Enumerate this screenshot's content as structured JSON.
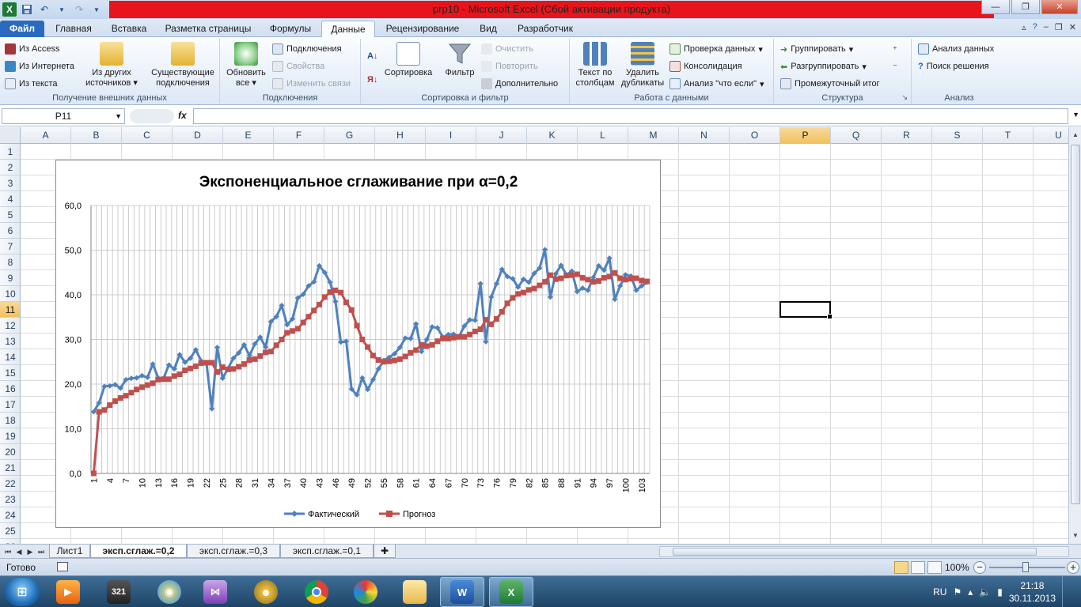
{
  "window": {
    "title": "prp10 -  Microsoft Excel (Сбой активации продукта)"
  },
  "tabs": [
    "Файл",
    "Главная",
    "Вставка",
    "Разметка страницы",
    "Формулы",
    "Данные",
    "Рецензирование",
    "Вид",
    "Разработчик"
  ],
  "ribbon": {
    "external": {
      "label": "Получение внешних данных",
      "access": "Из Access",
      "web": "Из Интернета",
      "text": "Из текста",
      "other1": "Из других",
      "other2": "источников",
      "existing1": "Существующие",
      "existing2": "подключения"
    },
    "connections": {
      "label": "Подключения",
      "refresh1": "Обновить",
      "refresh2": "все",
      "conn": "Подключения",
      "props": "Свойства",
      "links": "Изменить связи"
    },
    "sortfilter": {
      "label": "Сортировка и фильтр",
      "sort": "Сортировка",
      "filter": "Фильтр",
      "clear": "Очистить",
      "reapply": "Повторить",
      "advanced": "Дополнительно"
    },
    "datatools": {
      "label": "Работа с данными",
      "ttc1": "Текст по",
      "ttc2": "столбцам",
      "dup1": "Удалить",
      "dup2": "дубликаты",
      "validate": "Проверка данных",
      "consolidate": "Консолидация",
      "whatif": "Анализ \"что если\""
    },
    "outline": {
      "label": "Структура",
      "group": "Группировать",
      "ungroup": "Разгруппировать",
      "subtotal": "Промежуточный итог"
    },
    "analysis": {
      "label": "Анализ",
      "data": "Анализ данных",
      "solver": "Поиск решения"
    }
  },
  "formula_bar": {
    "name_box": "P11",
    "fx": "fx",
    "value": ""
  },
  "columns": [
    "A",
    "B",
    "C",
    "D",
    "E",
    "F",
    "G",
    "H",
    "I",
    "J",
    "K",
    "L",
    "M",
    "N",
    "O",
    "P",
    "Q",
    "R",
    "S",
    "T",
    "U"
  ],
  "rows": [
    "1",
    "2",
    "3",
    "4",
    "5",
    "6",
    "7",
    "8",
    "9",
    "10",
    "11",
    "12",
    "13",
    "14",
    "15",
    "16",
    "17",
    "18",
    "19",
    "20",
    "21",
    "22",
    "23",
    "24",
    "25",
    "26"
  ],
  "selected": {
    "column": "P",
    "row": "11"
  },
  "sheets": [
    "Лист1",
    "эксп.сглаж.=0,2",
    "эксп.сглаж.=0,3",
    "эксп.сглаж.=0,1"
  ],
  "active_sheet": 1,
  "status": {
    "ready": "Готово",
    "zoom": "100%"
  },
  "tray": {
    "lang": "RU",
    "time": "21:18",
    "date": "30.11.2013"
  },
  "colors": {
    "actual": "#4f81bd",
    "forecast": "#c0504d",
    "title_bar": "#e8141b"
  },
  "icons": [
    "excel-icon",
    "save-icon",
    "undo-icon",
    "redo-icon",
    "start-orb-icon",
    "media-player-icon",
    "clapper-icon",
    "browser-icon",
    "visual-studio-icon",
    "bird-icon",
    "chrome-icon",
    "colorful-app-icon",
    "folder-icon",
    "word-icon",
    "excel-taskbar-icon"
  ],
  "chart_data": {
    "type": "line",
    "title": "Экспоненциальное сглаживание при α=0,2",
    "xlabel": "",
    "ylabel": "",
    "ylim": [
      0,
      60
    ],
    "yticks": [
      "0,0",
      "10,0",
      "20,0",
      "30,0",
      "40,0",
      "50,0",
      "60,0"
    ],
    "xticks": [
      1,
      4,
      7,
      10,
      13,
      16,
      19,
      22,
      25,
      28,
      31,
      34,
      37,
      40,
      43,
      46,
      49,
      52,
      55,
      58,
      61,
      64,
      67,
      70,
      73,
      76,
      79,
      82,
      85,
      88,
      91,
      94,
      97,
      100,
      103
    ],
    "x_range": [
      1,
      104
    ],
    "grid": "vertical+horizontal",
    "legend_position": "bottom",
    "series": [
      {
        "name": "Фактический",
        "color": "#4f81bd",
        "marker": "diamond",
        "values": [
          13.8,
          15.8,
          19.5,
          19.6,
          19.9,
          19.1,
          21.0,
          21.3,
          21.4,
          21.9,
          21.5,
          24.5,
          21.4,
          21.3,
          24.3,
          23.4,
          26.6,
          24.9,
          25.8,
          27.7,
          25.2,
          24.5,
          14.5,
          28.2,
          21.3,
          23.5,
          25.8,
          27.0,
          28.8,
          26.4,
          29.0,
          30.5,
          28.3,
          34.0,
          35.1,
          37.6,
          33.3,
          34.6,
          39.3,
          40.1,
          42.0,
          42.9,
          46.5,
          45.0,
          42.8,
          38.5,
          29.4,
          29.6,
          18.9,
          17.6,
          21.4,
          18.8,
          21.0,
          23.4,
          25.3,
          26.0,
          26.8,
          28.2,
          30.3,
          30.2,
          33.5,
          27.3,
          30.0,
          32.8,
          32.6,
          30.5,
          31.1,
          31.2,
          30.6,
          33.0,
          34.4,
          34.3,
          42.5,
          29.5,
          39.5,
          42.5,
          45.7,
          44.1,
          43.6,
          41.7,
          43.5,
          42.8,
          44.8,
          46.0,
          50.1,
          39.5,
          44.7,
          46.6,
          44.5,
          45.3,
          40.7,
          41.5,
          41.0,
          43.9,
          46.5,
          45.5,
          48.2,
          39.0,
          42.0,
          44.5,
          44.2,
          41.0,
          42.0,
          42.8
        ]
      },
      {
        "name": "Прогноз",
        "color": "#c0504d",
        "marker": "square",
        "values": [
          0.0,
          13.8,
          14.2,
          15.3,
          16.2,
          16.9,
          17.4,
          18.1,
          18.8,
          19.3,
          19.8,
          20.2,
          21.0,
          21.1,
          21.1,
          21.8,
          22.2,
          23.1,
          23.5,
          24.0,
          24.7,
          24.8,
          24.8,
          22.7,
          23.8,
          23.3,
          23.4,
          23.9,
          24.5,
          25.4,
          25.6,
          26.3,
          27.1,
          27.3,
          28.7,
          30.0,
          31.5,
          31.9,
          32.4,
          33.8,
          35.1,
          36.5,
          37.8,
          39.5,
          40.6,
          41.0,
          40.5,
          38.3,
          36.6,
          33.1,
          30.0,
          28.3,
          26.4,
          25.4,
          25.0,
          25.1,
          25.3,
          25.6,
          26.2,
          27.0,
          27.6,
          28.8,
          28.5,
          28.8,
          29.6,
          30.2,
          30.2,
          30.4,
          30.6,
          30.6,
          31.1,
          31.8,
          32.3,
          34.4,
          33.4,
          34.6,
          36.2,
          38.1,
          39.3,
          40.2,
          40.5,
          41.1,
          41.4,
          42.1,
          42.9,
          44.4,
          43.5,
          43.7,
          44.3,
          44.4,
          44.6,
          43.8,
          43.4,
          42.9,
          43.1,
          43.8,
          44.1,
          44.9,
          43.7,
          43.4,
          43.6,
          43.7,
          43.2,
          43.0
        ]
      }
    ]
  }
}
